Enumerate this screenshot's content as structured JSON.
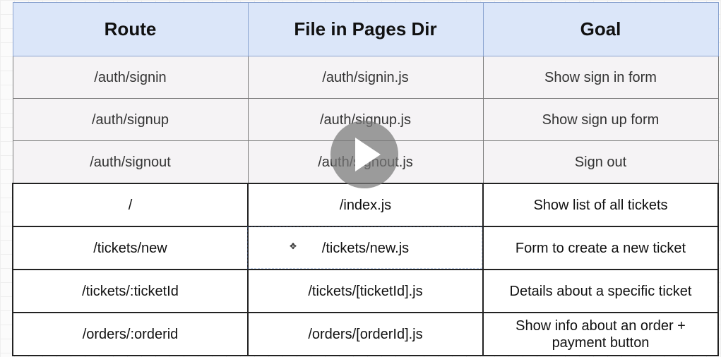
{
  "table": {
    "headers": [
      "Route",
      "File in Pages Dir",
      "Goal"
    ],
    "rows": [
      {
        "route": "/auth/signin",
        "file": "/auth/signin.js",
        "goal": "Show sign in form"
      },
      {
        "route": "/auth/signup",
        "file": "/auth/signup.js",
        "goal": "Show sign up form"
      },
      {
        "route": "/auth/signout",
        "file": "/auth/signout.js",
        "goal": "Sign out"
      },
      {
        "route": "/",
        "file": "/index.js",
        "goal": "Show list of all tickets"
      },
      {
        "route": "/tickets/new",
        "file": "/tickets/new.js",
        "goal": "Form to create a new ticket"
      },
      {
        "route": "/tickets/:ticketId",
        "file": "/tickets/[ticketId].js",
        "goal": "Details about a specific ticket"
      },
      {
        "route": "/orders/:orderid",
        "file": "/orders/[orderId].js",
        "goal": "Show info about an order + payment button"
      }
    ]
  },
  "overlay": {
    "play_icon": "play-icon",
    "cursor_icon": "move-cursor-icon",
    "cursor_glyph": "✥"
  },
  "colors": {
    "header_bg": "#dbe6f9",
    "grey_row_bg": "#f5f3f5",
    "play_bg": "#787878"
  }
}
